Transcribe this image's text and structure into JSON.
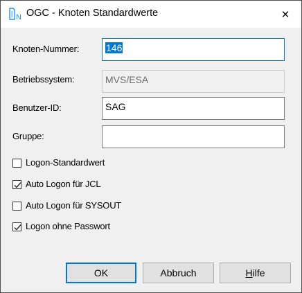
{
  "window": {
    "title": "OGC - Knoten Standardwerte",
    "close_glyph": "✕",
    "app_icon": "ogc-node-icon"
  },
  "fields": [
    {
      "label": "Knoten-Nummer:",
      "value": "146",
      "state": "focused-selected"
    },
    {
      "label": "Betriebssystem:",
      "value": "MVS/ESA",
      "state": "disabled"
    },
    {
      "label": "Benutzer-ID:",
      "value": "SAG",
      "state": "normal"
    },
    {
      "label": "Gruppe:",
      "value": "",
      "state": "normal"
    }
  ],
  "checkboxes": [
    {
      "label": "Logon-Standardwert",
      "checked": false
    },
    {
      "label": "Auto Logon für JCL",
      "checked": true
    },
    {
      "label": "Auto Logon für SYSOUT",
      "checked": false
    },
    {
      "label": "Logon ohne Passwort",
      "checked": true
    }
  ],
  "buttons": {
    "ok": "OK",
    "cancel": "Abbruch",
    "help_mnemonic": "H",
    "help_rest": "ilfe"
  },
  "colors": {
    "accent": "#0078d7",
    "dialog_bg": "#f0f0f0"
  }
}
